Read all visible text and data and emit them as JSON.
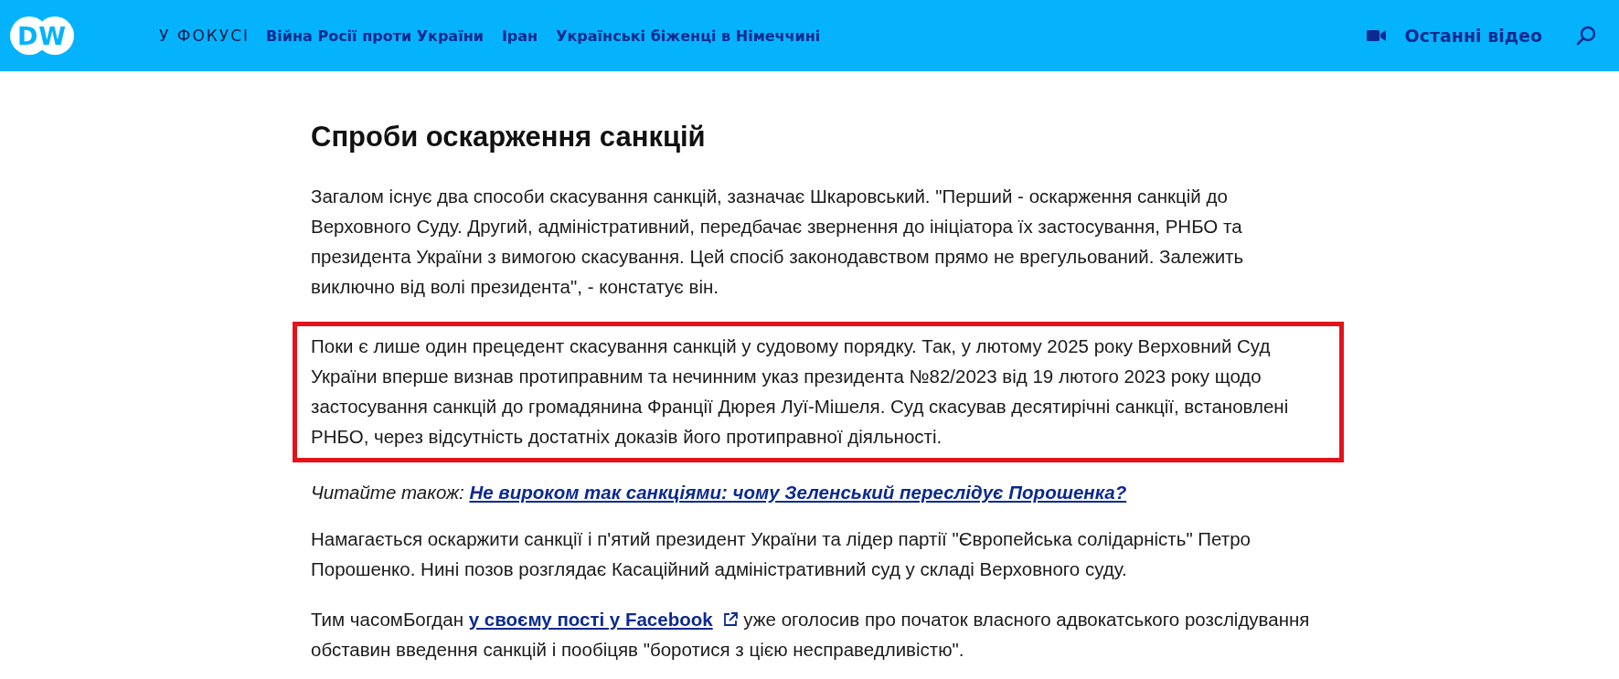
{
  "header": {
    "logo": "DW",
    "focus_label": "У ФОКУСІ",
    "nav_links": [
      "Війна Росії проти України",
      "Іран",
      "Українські біженці в Німеччині"
    ],
    "latest_video": "Останні відео"
  },
  "article": [
    {
      "kind": "heading",
      "text": "Спроби оскарження санкцій"
    },
    {
      "kind": "paragraph",
      "highlighted": false,
      "text": "Загалом існує два способи скасування санкцій, зазначає Шкаровський. \"Перший - оскарження санкцій до Верховного Суду. Другий, адміністративний, передбачає звернення до ініціатора їх застосування, РНБО та президента України з вимогою скасування. Цей спосіб законодавством прямо не врегульований. Залежить виключно від волі президента\", - констатує  він."
    },
    {
      "kind": "paragraph",
      "highlighted": true,
      "text": "Поки є лише один прецедент скасування санкцій у судовому порядку. Так, у лютому 2025 року Верховний Суд України вперше визнав протиправним та нечинним указ президента №82/2023 від 19 лютого 2023 року щодо застосування санкцій до громадянина Франції Дюрея Луї-Мішеля. Суд скасував десятирічні санкції, встановлені РНБО, через відсутність достатніх доказів його протиправної діяльності."
    },
    {
      "kind": "read_also",
      "label": "Читайте також:",
      "link": "Не вироком так санкціями: чому Зеленський переслідує Порошенка?"
    },
    {
      "kind": "paragraph",
      "highlighted": false,
      "text": "Намагається оскаржити санкції і п'ятий президент України та лідер партії \"Європейська солідарність\" Петро Порошенко. Нині позов розглядає Касаційний адміністративний суд у складі Верховного суду."
    },
    {
      "kind": "paragraph_link",
      "before": "Тим часомБогдан",
      "link": "у своєму пості у Facebook",
      "after": "уже оголосив про початок власного адвокатського розслідування обставин введення санкцій і пообіцяв \"боротися з цією несправедливістю\"."
    }
  ]
}
